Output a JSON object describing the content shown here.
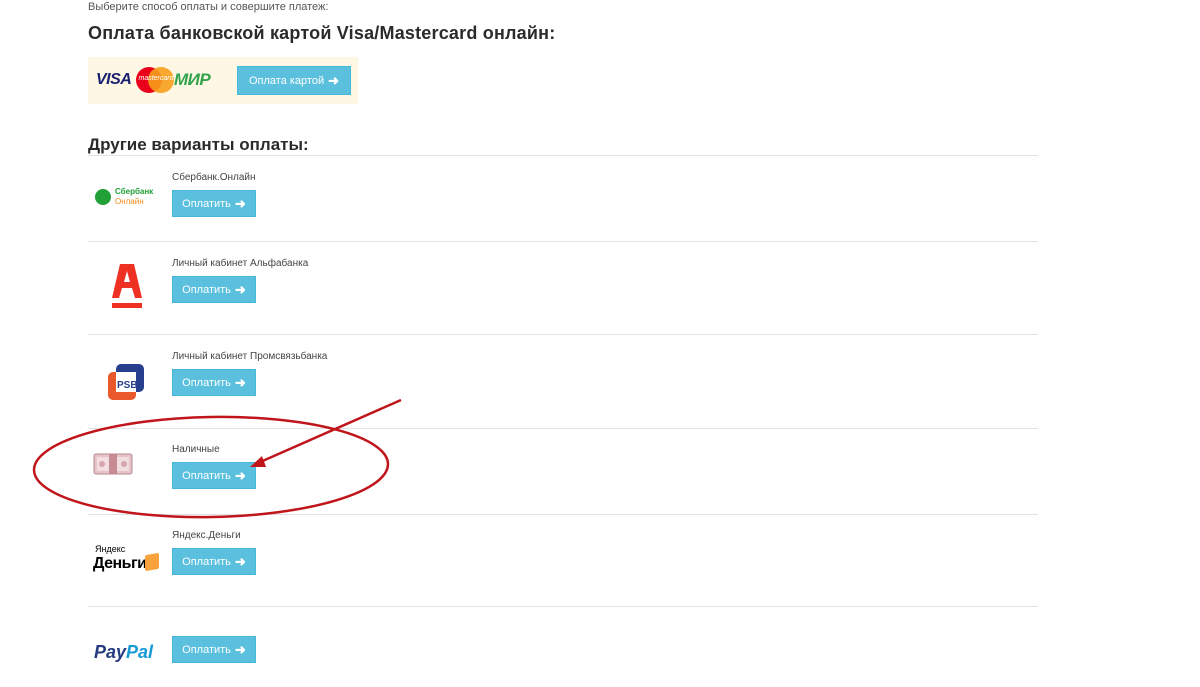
{
  "intro_text": "Выберите способ оплаты и совершите платеж:",
  "card_section": {
    "title": "Оплата банковской картой Visa/Mastercard онлайн:",
    "logos": {
      "visa": "VISA",
      "mastercard": "mastercard",
      "mir": "МИР"
    },
    "button_label": "Оплата картой",
    "button_icon": "arrow-right-icon"
  },
  "other_section": {
    "title": "Другие варианты оплаты:",
    "options": [
      {
        "label": "Сбербанк.Онлайн",
        "logo": "sberbank-online-logo",
        "logo_text": [
          "Сбербанк",
          "Онлайн"
        ],
        "button_label": "Оплатить"
      },
      {
        "label": "Личный кабинет Альфабанка",
        "logo": "alfabank-logo",
        "button_label": "Оплатить"
      },
      {
        "label": "Личный кабинет Промсвязьбанка",
        "logo": "psb-logo",
        "button_label": "Оплатить"
      },
      {
        "label": "Наличные",
        "logo": "cash-icon",
        "button_label": "Оплатить"
      },
      {
        "label": "Яндекс.Деньги",
        "logo": "yandex-money-logo",
        "logo_text": [
          "Яндекс",
          "Деньги"
        ],
        "button_label": "Оплатить"
      },
      {
        "label": "",
        "logo": "paypal-logo",
        "logo_text": [
          "Pay",
          "Pal"
        ],
        "button_label": "Оплатить"
      }
    ]
  },
  "colors": {
    "button_bg": "#5bc0de",
    "heading": "#2b2b2b",
    "annotation_red": "#c0151b",
    "card_box_bg": "#fdf7e3"
  }
}
